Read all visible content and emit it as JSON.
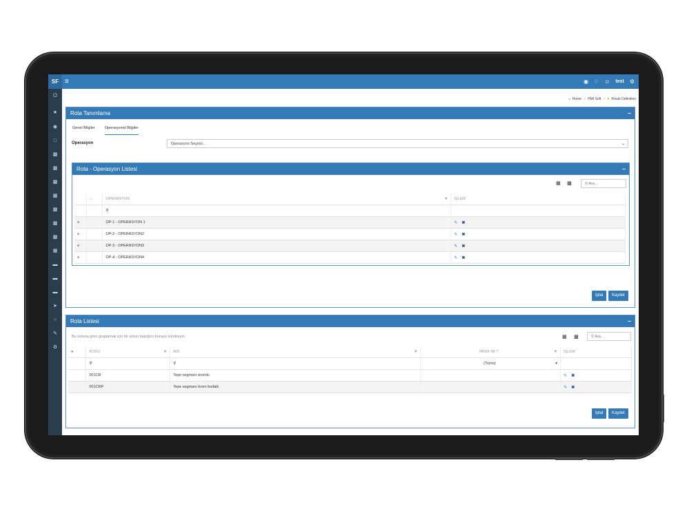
{
  "app": {
    "logo": "SF",
    "menu_icon": "hamburger-icon"
  },
  "topbar": {
    "user": "test"
  },
  "breadcrumb": [
    "Home",
    "HMI Soft",
    "Route Definition"
  ],
  "rota_tanimlama": {
    "title": "Rota Tanımlama",
    "tabs": [
      "Genel Bilgiler",
      "Operasyonel Bilgiler"
    ],
    "active_tab": 1,
    "operasyon_label": "Operasyon",
    "operasyon_placeholder": "Operasyon Seçiniz...",
    "inner_panel": {
      "title": "Rota - Operasyon Listesi",
      "search_placeholder": "Ara...",
      "columns": [
        "OPERASYON",
        "İŞLEM"
      ],
      "rows": [
        "OP-1 - OPERASYON 1",
        "OP-2 - OPERASYON2",
        "OP-3 - OPERASYON3",
        "OP-4 - OPERASYON4"
      ]
    },
    "cancel_label": "İptal",
    "save_label": "Kaydet"
  },
  "rota_listesi": {
    "title": "Rota Listesi",
    "group_hint": "Bu sütuna göre gruplamak için bir sütun başlığını buraya sürükleyin",
    "search_placeholder": "Ara...",
    "columns": [
      "KODU",
      "ADI",
      "PASİF Mİ ?",
      "İŞLEM"
    ],
    "filter_select": "(Tümü)",
    "rows": [
      {
        "kodu": "001CR",
        "adi": "Tepe segmanı kromlu"
      },
      {
        "kodu": "001CRP",
        "adi": "Tepe segmanı krom fosfatlı"
      }
    ],
    "cancel_label": "İptal",
    "save_label": "Kaydet"
  },
  "colors": {
    "primary": "#337ab7",
    "sidebar": "#2a3d4f"
  }
}
